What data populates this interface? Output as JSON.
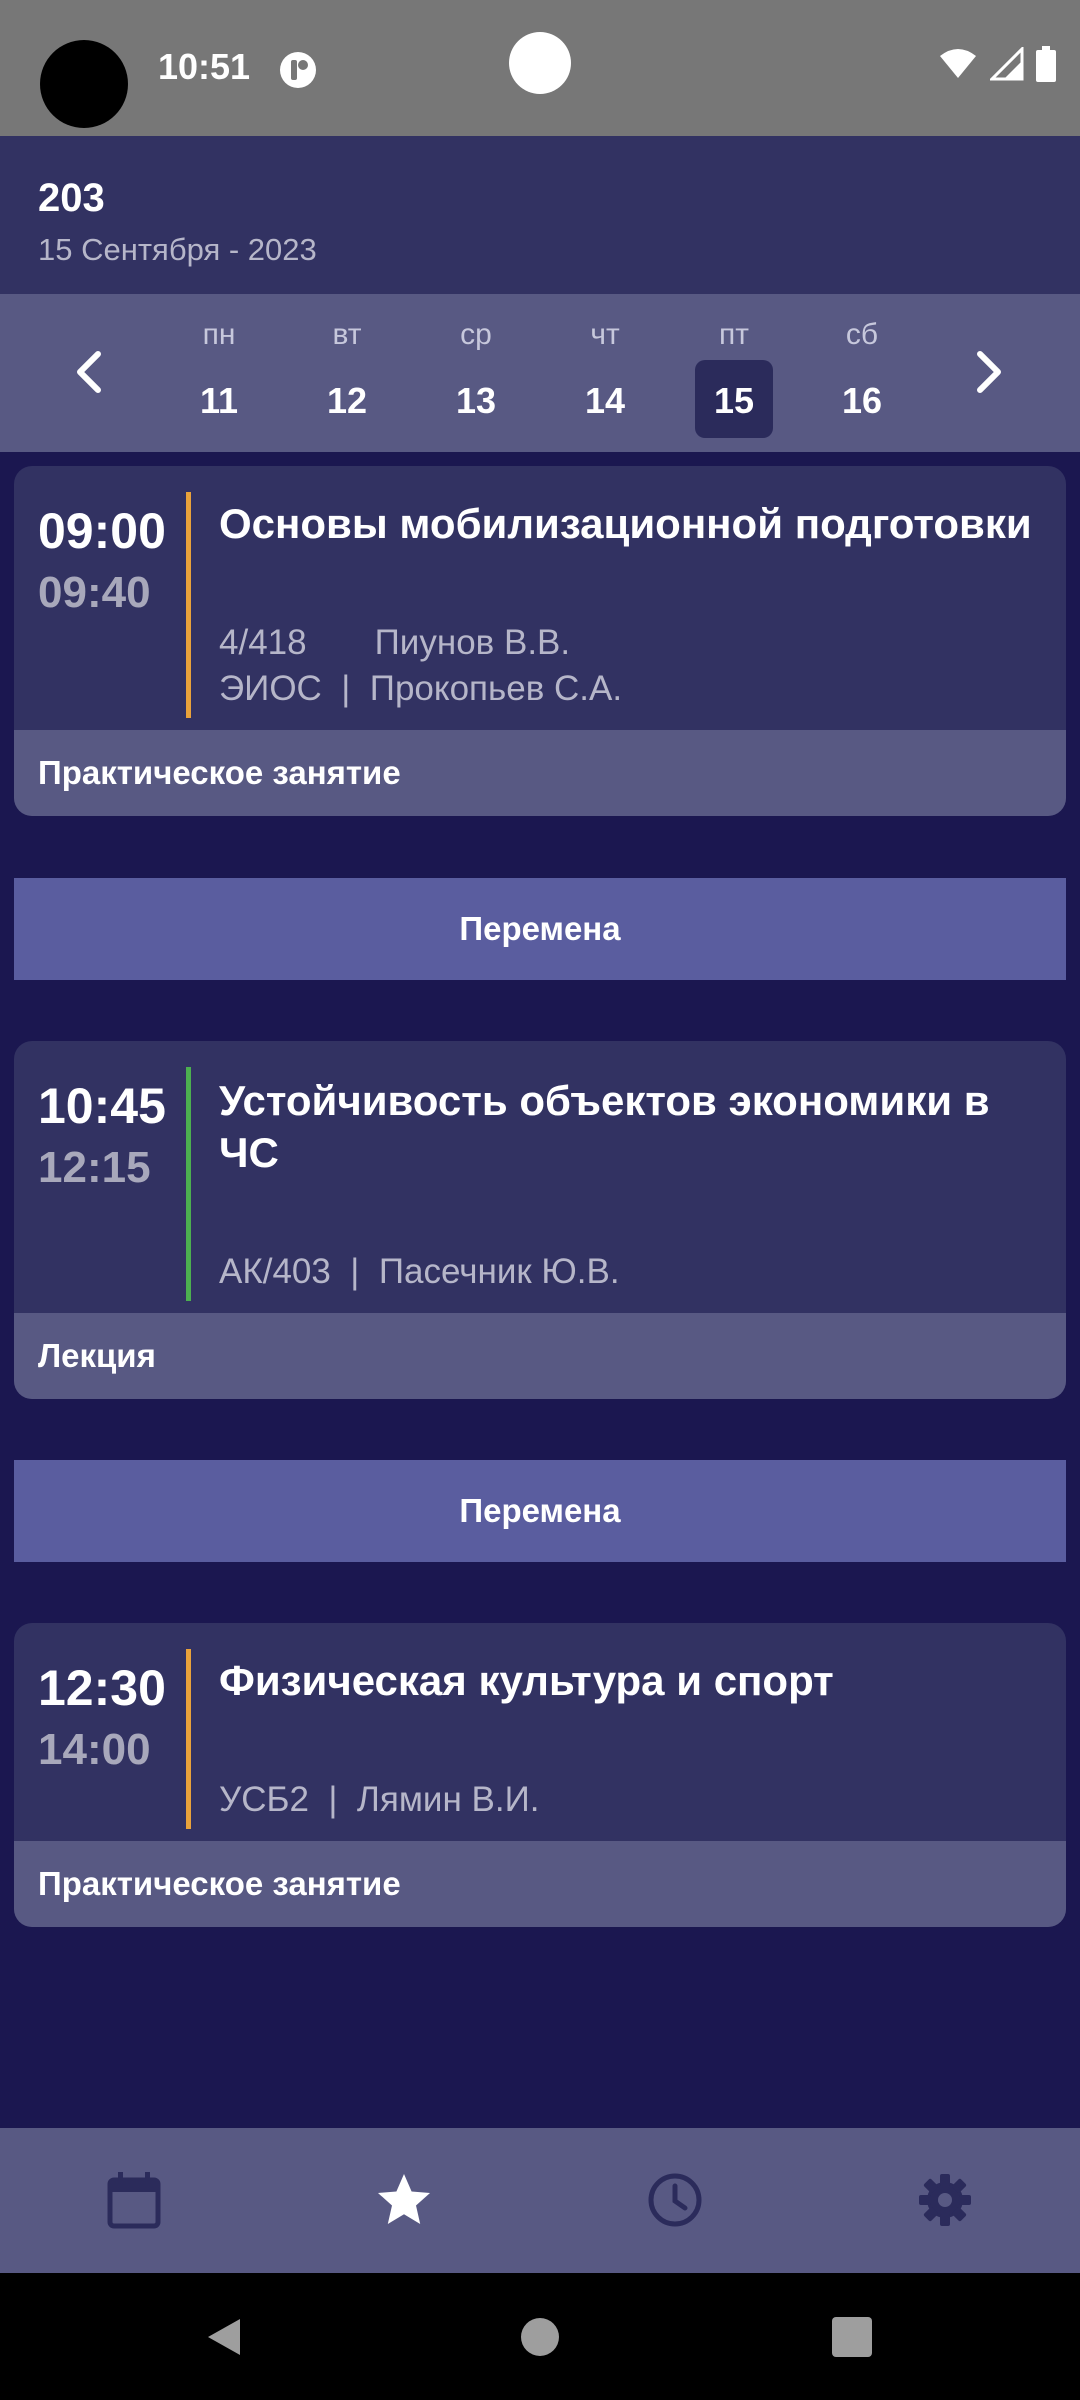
{
  "status_bar": {
    "time": "10:51",
    "icons": [
      "notification-icon",
      "wifi-icon",
      "signal-icon",
      "battery-icon"
    ]
  },
  "header": {
    "group": "203",
    "date": "15 Сентября - 2023"
  },
  "week": {
    "days": [
      {
        "name": "пн",
        "num": "11"
      },
      {
        "name": "вт",
        "num": "12"
      },
      {
        "name": "ср",
        "num": "13"
      },
      {
        "name": "чт",
        "num": "14"
      },
      {
        "name": "пт",
        "num": "15"
      },
      {
        "name": "сб",
        "num": "16"
      }
    ],
    "selected": "15"
  },
  "lessons": [
    {
      "start": "09:00",
      "end": "09:40",
      "title": "Основы мобилизационной подготовки",
      "info_line1": "4/418       Пиунов В.В.",
      "info_line2": "ЭИОС  |  Прокопьев С.А.",
      "type": "Практическое занятие",
      "accent": "#e9a23b"
    },
    {
      "start": "10:45",
      "end": "12:15",
      "title": "Устойчивость объектов экономики в ЧС",
      "info_line1": "АК/403  |  Пасечник Ю.В.",
      "type": "Лекция",
      "accent": "#4caf50"
    },
    {
      "start": "12:30",
      "end": "14:00",
      "title": "Физическая культура и спорт",
      "info_line1": "УСБ2  |  Лямин В.И.",
      "type": "Практическое занятие",
      "accent": "#e9a23b"
    }
  ],
  "breaks": [
    "Перемена",
    "Перемена"
  ],
  "bottom_nav": [
    "calendar-icon",
    "star-icon",
    "clock-icon",
    "settings-icon"
  ],
  "colors": {
    "background": "#1b1750",
    "card": "#323262",
    "strip": "#585983",
    "break": "#5a5d9f"
  }
}
